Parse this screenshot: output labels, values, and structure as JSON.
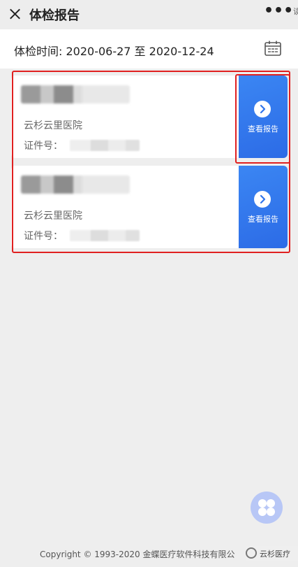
{
  "header": {
    "title": "体检报告",
    "more_label": "•••",
    "edge_char": "读"
  },
  "date_filter": {
    "label": "体检时间: 2020-06-27 至 2020-12-24"
  },
  "reports": [
    {
      "hospital": "云杉云里医院",
      "cert_label": "证件号：",
      "view_label": "查看报告"
    },
    {
      "hospital": "云杉云里医院",
      "cert_label": "证件号：",
      "view_label": "查看报告"
    }
  ],
  "footer": {
    "copyright": "Copyright © 1993-2020 金蝶医疗软件科技有限公"
  },
  "watermark": {
    "text": "云杉医疗"
  },
  "colors": {
    "accent": "#2f74ec",
    "highlight_box": "#e02020",
    "fab": "#b8c7f6"
  },
  "icons": {
    "close": "close-icon",
    "more": "more-icon",
    "calendar": "calendar-icon",
    "arrow": "chevron-right-icon",
    "fab": "grid-menu-icon"
  }
}
